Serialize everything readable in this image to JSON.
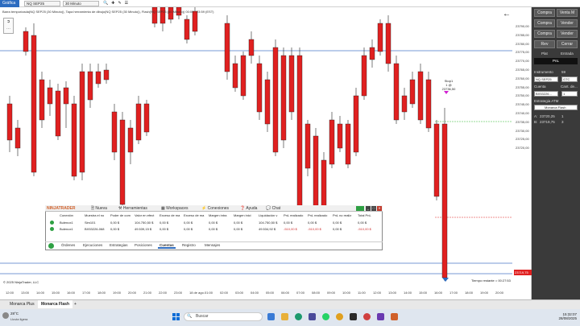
{
  "topbar": {
    "tab_label": "Gráfica",
    "instrument": "NQ SEP25",
    "interval": "30 Minuto"
  },
  "chart": {
    "info_text": "Barra temporizada(NQ SEP25 (30 Minuto)), Tapa herramienta de dibujo(NQ SEP25 (30 Minuto)), Flash(NQ SEP25 (30 Minuto)) 00:00 - 23:59 (EST)",
    "copyright": "© 2025 NinjaTrader, LLC",
    "remaining_time": "Tiempo restante = 00:27:53",
    "order_label": "Stop1",
    "order_detail": "1 @ 23736,50",
    "price_labels": [
      "23790,00",
      "23785,00",
      "23780,00",
      "23775,00",
      "23770,00",
      "23765,00",
      "23760,00",
      "23755,00",
      "23750,00",
      "23745,00",
      "23740,00",
      "23735,00",
      "23730,00",
      "23725,00",
      "23720,00"
    ],
    "current_price": "23719,75",
    "time_labels": [
      "12:00",
      "13:00",
      "14:00",
      "15:00",
      "16:00",
      "17:00",
      "18:00",
      "19:00",
      "20:00",
      "21:00",
      "22:00",
      "23:00",
      "18 de ago.",
      "01:00",
      "02:00",
      "03:00",
      "04:00",
      "05:00",
      "06:00",
      "07:00",
      "08:00",
      "09:00",
      "10:00",
      "11:00",
      "12:00",
      "13:00",
      "14:00",
      "15:00",
      "16:00",
      "17:00",
      "18:00",
      "19:00",
      "20:00"
    ]
  },
  "right_panel": {
    "buttons": [
      [
        "Compra",
        "Venta M"
      ],
      [
        "Compra",
        "Vender"
      ],
      [
        "Compra",
        "Vender"
      ],
      [
        "Rev",
        "Cerrar"
      ]
    ],
    "tab_flat": "Plat",
    "tab_entry": "Entrada",
    "pnl_label": "PnL",
    "instrument_label": "Instrumento",
    "instrument_value": "59",
    "instrument_select": "NQ SEP25",
    "tif": "GTC",
    "account_label": "Cuenta",
    "qty_label": "Cant. de...",
    "account_value": "BX53226...",
    "qty_value": "1",
    "atm_label": "Estrategia ATM",
    "atm_value": "Monarca Flash",
    "a_label": "A:",
    "a_price": "23720,25",
    "a_qty": "1",
    "b_label": "B:",
    "b_price": "23719,75",
    "b_qty": "3"
  },
  "control_center": {
    "brand": "NINJATRADER",
    "menu": [
      "Nueva",
      "Herramientas",
      "Workspaces",
      "Conexiones",
      "Ayuda",
      "Chat"
    ],
    "columns": [
      "Conexión",
      "Muestra el no",
      "Poder de com",
      "Valor en efect",
      "Exceso de ma",
      "Exceso de ma",
      "Margen intra",
      "Margen inici",
      "Liquidación v",
      "PnL realizado",
      "PnL realizado",
      "PnL no realiz",
      "Total PnL"
    ],
    "rows": [
      [
        "Bulenox1",
        "Sim101",
        "0,00 $",
        "104.750,50 $",
        "0,00 $",
        "0,00 $",
        "0,00 $",
        "0,00 $",
        "104.750,50 $",
        "0,00 $",
        "0,00 $",
        "0,00 $",
        "0,00 $"
      ],
      [
        "Bulenox1",
        "BX53226-068",
        "0,00 $",
        "49.539,15 $",
        "0,00 $",
        "0,00 $",
        "0,00 $",
        "0,00 $",
        "49.534,92 $",
        "-510,00 $",
        "-510,00 $",
        "0,00 $",
        "-510,00 $"
      ]
    ],
    "tabs": [
      "Órdenes",
      "Ejecuciones",
      "Estrategias",
      "Posiciones",
      "Cuentas",
      "Registro",
      "Mensajes"
    ],
    "active_tab": "Cuentas"
  },
  "bottom_tabs": {
    "tab1": "Monarca Plus",
    "tab2": "Monarca Flash",
    "add": "+"
  },
  "taskbar": {
    "temp": "28°C",
    "weather": "Lluvia ligera",
    "search": "Buscar",
    "time": "15:32:07",
    "date": "28/08/2025"
  },
  "colors": {
    "bull": "#2eb82e",
    "bear": "#e02020",
    "accent": "#2d6cc0",
    "panel": "#3a3a3a"
  }
}
